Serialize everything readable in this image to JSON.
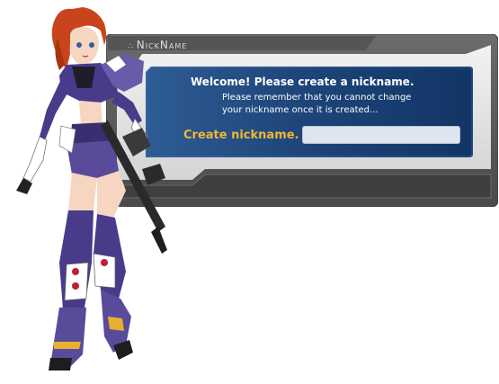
{
  "dialog": {
    "title": "NickName",
    "title_ornament": "∴"
  },
  "panel": {
    "welcome": "Welcome! Please create a nickname.",
    "notice_line1": "Please remember that you cannot change",
    "notice_line2": "your nickname once it is created...",
    "create_label": "Create nickname.",
    "input_value": "",
    "input_placeholder": ""
  },
  "colors": {
    "frame_dark": "#5a5a5a",
    "frame_light": "#d9d9d9",
    "panel_blue": "#1b3f72",
    "label_gold": "#f2b632",
    "input_bg": "#dfe5ee"
  }
}
